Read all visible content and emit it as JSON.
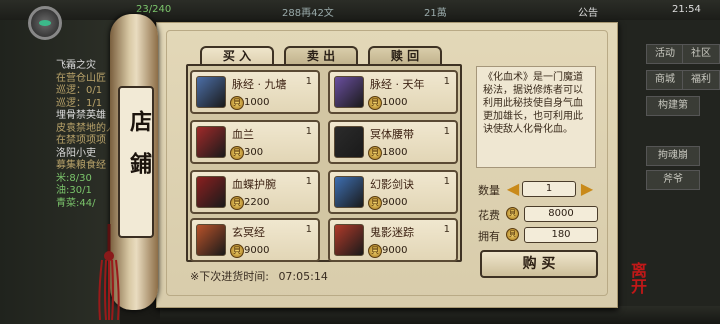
{
  "topbar": {
    "exp": "23/240",
    "silver": "288再42文",
    "copper": "21萬",
    "notice": "公告",
    "time": "21:54"
  },
  "left_panel": {
    "quests": [
      {
        "text": "飞霜之灾",
        "style": "white"
      },
      {
        "text": "在营仓山匠",
        "style": "plain"
      },
      {
        "text": "巡逻：0/1",
        "style": "plain"
      },
      {
        "text": "巡逻：1/1",
        "style": "plain"
      },
      {
        "text": "埋骨禁英雄",
        "style": "white"
      },
      {
        "text": "皮袁禁地的人",
        "style": "plain"
      },
      {
        "text": "在禁项项项",
        "style": "plain"
      },
      {
        "text": "洛阳小吏",
        "style": "white"
      },
      {
        "text": "募集粮食经",
        "style": "plain"
      },
      {
        "text": "米:8/30",
        "style": "green"
      },
      {
        "text": "油:30/1",
        "style": "green"
      },
      {
        "text": "青菜:44/",
        "style": "green"
      }
    ]
  },
  "right_panel": {
    "buttons": [
      "活动",
      "社区",
      "商城",
      "福利",
      "构建第",
      "拘魂崩",
      "斧爷"
    ]
  },
  "shop": {
    "title": "店鋪",
    "tabs": [
      "买 入",
      "卖 出",
      "赎 回"
    ],
    "active_tab": 0,
    "items": [
      {
        "name": "脉经 · 九塘",
        "qty": "1",
        "price": "1000",
        "icon_color": "#4c6fa8"
      },
      {
        "name": "脉经 · 天年",
        "qty": "1",
        "price": "1000",
        "icon_color": "#6a4fa0"
      },
      {
        "name": "血兰",
        "qty": "1",
        "price": "300",
        "icon_color": "#a02a2a"
      },
      {
        "name": "冥体腰带",
        "qty": "1",
        "price": "1800",
        "icon_color": "#2b2b2b"
      },
      {
        "name": "血蝶护腕",
        "qty": "1",
        "price": "2200",
        "icon_color": "#8a2020"
      },
      {
        "name": "幻影剑诀",
        "qty": "1",
        "price": "9000",
        "icon_color": "#3e6fb2"
      },
      {
        "name": "玄冥经",
        "qty": "1",
        "price": "9000",
        "icon_color": "#b8522a"
      },
      {
        "name": "鬼影迷踪",
        "qty": "1",
        "price": "9000",
        "icon_color": "#b03a2a"
      }
    ],
    "restock_label": "※下次进货时间:",
    "restock_time": "07:05:14",
    "description": "《化血术》是一门魔道秘法，据说修炼者可以利用此秘技使自身气血更加雄长，也可利用此诀使敌人化骨化血。",
    "quantity_label": "数量",
    "quantity_value": "1",
    "cost_label": "花费",
    "cost_value": "8000",
    "owned_label": "拥有",
    "owned_value": "180",
    "buy_label": "购 买",
    "stamp": "离开"
  }
}
